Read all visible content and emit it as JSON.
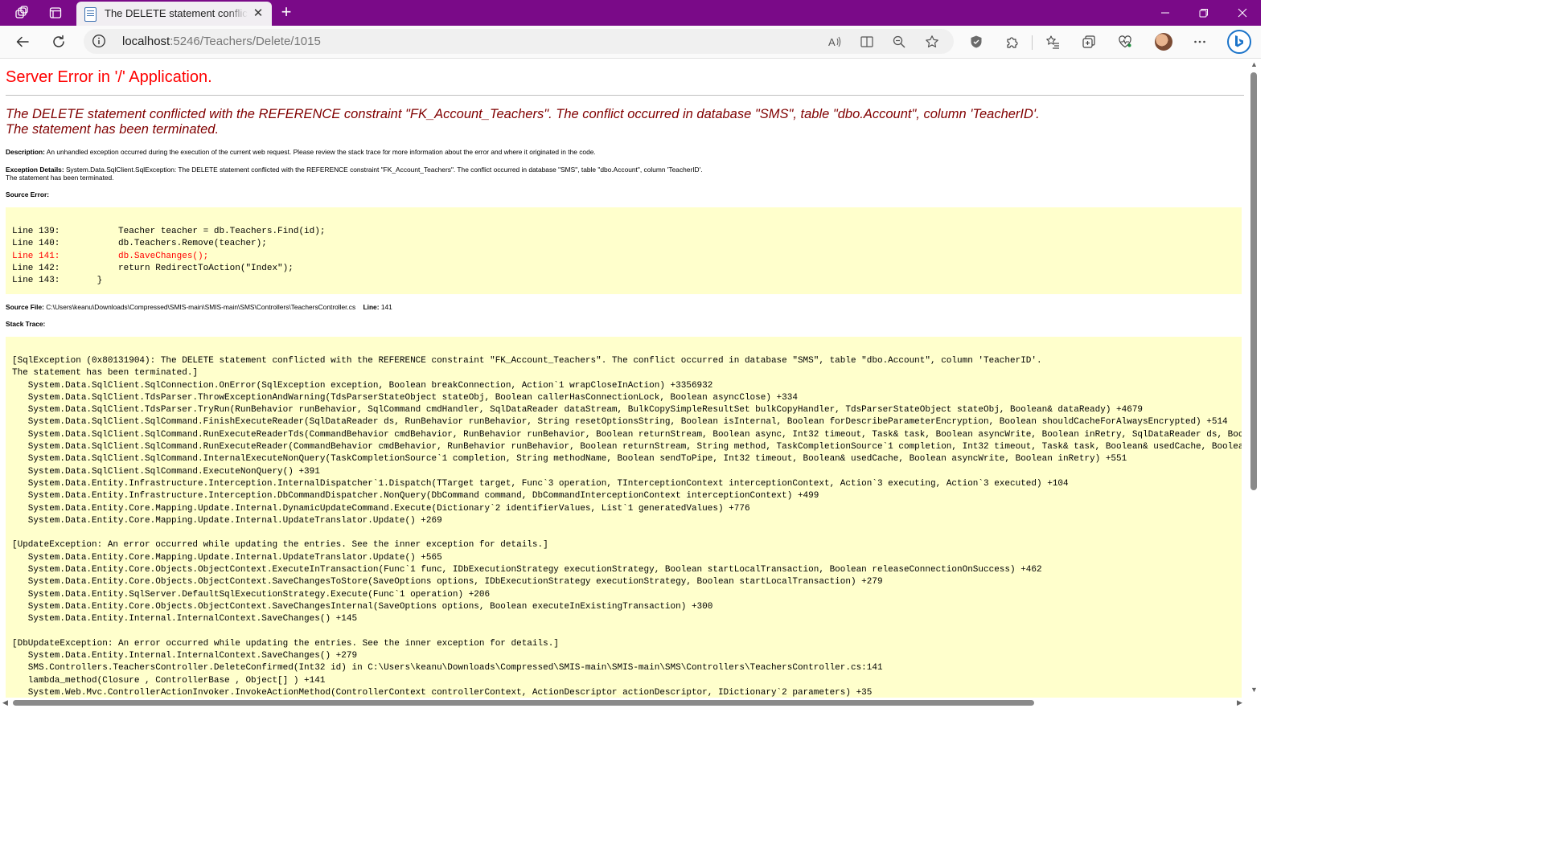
{
  "browser": {
    "tab_title": "The DELETE statement conflicted",
    "url_host": "localhost",
    "url_path": ":5246/Teachers/Delete/1015"
  },
  "page": {
    "title": "Server Error in '/' Application.",
    "message_line1": "The DELETE statement conflicted with the REFERENCE constraint \"FK_Account_Teachers\". The conflict occurred in database \"SMS\", table \"dbo.Account\", column 'TeacherID'.",
    "message_line2": "The statement has been terminated.",
    "description_label": "Description:",
    "description_text": "An unhandled exception occurred during the execution of the current web request. Please review the stack trace for more information about the error and where it originated in the code.",
    "exception_label": "Exception Details:",
    "exception_text": "System.Data.SqlClient.SqlException: The DELETE statement conflicted with the REFERENCE constraint \"FK_Account_Teachers\". The conflict occurred in database \"SMS\", table \"dbo.Account\", column 'TeacherID'.",
    "exception_text2": "The statement has been terminated.",
    "source_error_label": "Source Error:",
    "source_lines": [
      "Line 139:           Teacher teacher = db.Teachers.Find(id);",
      "Line 140:           db.Teachers.Remove(teacher);",
      "Line 141:           db.SaveChanges();",
      "Line 142:           return RedirectToAction(\"Index\");",
      "Line 143:       }"
    ],
    "source_file_label": "Source File:",
    "source_file": "C:\\Users\\keanu\\Downloads\\Compressed\\SMIS-main\\SMIS-main\\SMS\\Controllers\\TeachersController.cs",
    "line_label": "Line:",
    "line_number": "141",
    "stack_trace_label": "Stack Trace:",
    "stack_trace": [
      "[SqlException (0x80131904): The DELETE statement conflicted with the REFERENCE constraint \"FK_Account_Teachers\". The conflict occurred in database \"SMS\", table \"dbo.Account\", column 'TeacherID'.",
      "The statement has been terminated.]",
      "   System.Data.SqlClient.SqlConnection.OnError(SqlException exception, Boolean breakConnection, Action`1 wrapCloseInAction) +3356932",
      "   System.Data.SqlClient.TdsParser.ThrowExceptionAndWarning(TdsParserStateObject stateObj, Boolean callerHasConnectionLock, Boolean asyncClose) +334",
      "   System.Data.SqlClient.TdsParser.TryRun(RunBehavior runBehavior, SqlCommand cmdHandler, SqlDataReader dataStream, BulkCopySimpleResultSet bulkCopyHandler, TdsParserStateObject stateObj, Boolean& dataReady) +4679",
      "   System.Data.SqlClient.SqlCommand.FinishExecuteReader(SqlDataReader ds, RunBehavior runBehavior, String resetOptionsString, Boolean isInternal, Boolean forDescribeParameterEncryption, Boolean shouldCacheForAlwaysEncrypted) +514",
      "   System.Data.SqlClient.SqlCommand.RunExecuteReaderTds(CommandBehavior cmdBehavior, RunBehavior runBehavior, Boolean returnStream, Boolean async, Int32 timeout, Task& task, Boolean asyncWrite, Boolean inRetry, SqlDataReader ds, Boole",
      "   System.Data.SqlClient.SqlCommand.RunExecuteReader(CommandBehavior cmdBehavior, RunBehavior runBehavior, Boolean returnStream, String method, TaskCompletionSource`1 completion, Int32 timeout, Task& task, Boolean& usedCache, Boolean",
      "   System.Data.SqlClient.SqlCommand.InternalExecuteNonQuery(TaskCompletionSource`1 completion, String methodName, Boolean sendToPipe, Int32 timeout, Boolean& usedCache, Boolean asyncWrite, Boolean inRetry) +551",
      "   System.Data.SqlClient.SqlCommand.ExecuteNonQuery() +391",
      "   System.Data.Entity.Infrastructure.Interception.InternalDispatcher`1.Dispatch(TTarget target, Func`3 operation, TInterceptionContext interceptionContext, Action`3 executing, Action`3 executed) +104",
      "   System.Data.Entity.Infrastructure.Interception.DbCommandDispatcher.NonQuery(DbCommand command, DbCommandInterceptionContext interceptionContext) +499",
      "   System.Data.Entity.Core.Mapping.Update.Internal.DynamicUpdateCommand.Execute(Dictionary`2 identifierValues, List`1 generatedValues) +776",
      "   System.Data.Entity.Core.Mapping.Update.Internal.UpdateTranslator.Update() +269",
      "",
      "[UpdateException: An error occurred while updating the entries. See the inner exception for details.]",
      "   System.Data.Entity.Core.Mapping.Update.Internal.UpdateTranslator.Update() +565",
      "   System.Data.Entity.Core.Objects.ObjectContext.ExecuteInTransaction(Func`1 func, IDbExecutionStrategy executionStrategy, Boolean startLocalTransaction, Boolean releaseConnectionOnSuccess) +462",
      "   System.Data.Entity.Core.Objects.ObjectContext.SaveChangesToStore(SaveOptions options, IDbExecutionStrategy executionStrategy, Boolean startLocalTransaction) +279",
      "   System.Data.Entity.SqlServer.DefaultSqlExecutionStrategy.Execute(Func`1 operation) +206",
      "   System.Data.Entity.Core.Objects.ObjectContext.SaveChangesInternal(SaveOptions options, Boolean executeInExistingTransaction) +300",
      "   System.Data.Entity.Internal.InternalContext.SaveChanges() +145",
      "",
      "[DbUpdateException: An error occurred while updating the entries. See the inner exception for details.]",
      "   System.Data.Entity.Internal.InternalContext.SaveChanges() +279",
      "   SMS.Controllers.TeachersController.DeleteConfirmed(Int32 id) in C:\\Users\\keanu\\Downloads\\Compressed\\SMIS-main\\SMIS-main\\SMS\\Controllers\\TeachersController.cs:141",
      "   lambda_method(Closure , ControllerBase , Object[] ) +141",
      "   System.Web.Mvc.ControllerActionInvoker.InvokeActionMethod(ControllerContext controllerContext, ActionDescriptor actionDescriptor, IDictionary`2 parameters) +35"
    ]
  }
}
